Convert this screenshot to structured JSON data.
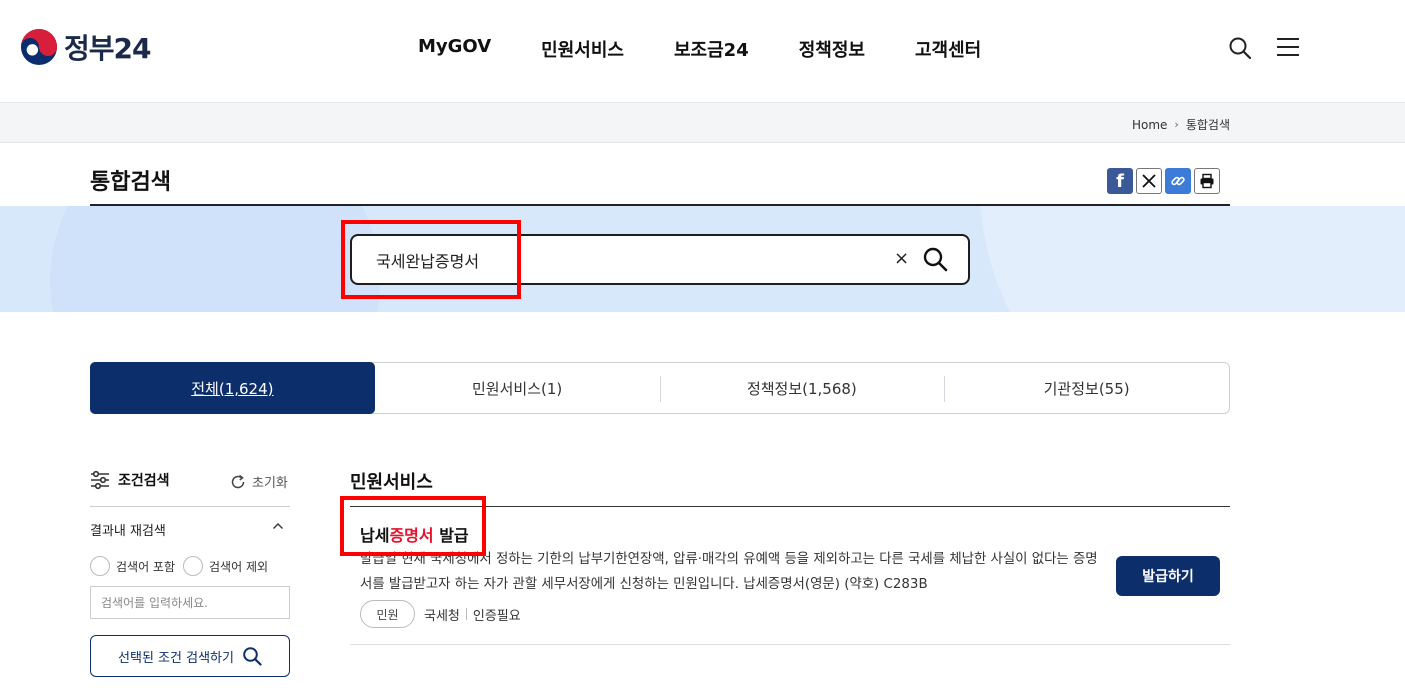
{
  "header": {
    "logo_text": "정부24",
    "nav": [
      "MyGOV",
      "민원서비스",
      "보조금24",
      "정책정보",
      "고객센터"
    ]
  },
  "breadcrumb": {
    "home": "Home",
    "current": "통합검색"
  },
  "page": {
    "title": "통합검색"
  },
  "share": {
    "facebook": "f"
  },
  "search": {
    "query": "국세완납증명서",
    "clear": "×"
  },
  "tabs": [
    {
      "label": "전체(1,624)",
      "active": true
    },
    {
      "label": "민원서비스(1)"
    },
    {
      "label": "정책정보(1,568)"
    },
    {
      "label": "기관정보(55)"
    }
  ],
  "filter": {
    "title": "조건검색",
    "reset": "초기화",
    "section": "결과내 재검색",
    "include": "검색어 포함",
    "exclude": "검색어 제외",
    "placeholder": "검색어를 입력하세요.",
    "button": "선택된 조건 검색하기"
  },
  "results": {
    "section_title": "민원서비스",
    "items": [
      {
        "title_pre": "납세",
        "title_hl": "증명서",
        "title_post": " 발급",
        "desc": "발급일 현재 국세청에서 정하는 기한의 납부기한연장액, 압류·매각의 유예액 등을 제외하고는 다른 국세를 체납한 사실이 없다는 증명서를 발급받고자 하는 자가 관할 세무서장에게 신청하는 민원입니다. 납세증명서(영문) (약호) C283B",
        "badge": "민원",
        "agency": "국세청",
        "auth": "인증필요",
        "action": "발급하기"
      }
    ]
  },
  "colors": {
    "primary": "#0c2f6b",
    "highlight": "#e4132b",
    "band": "#d8e8fb",
    "annotation": "#ff0000"
  }
}
